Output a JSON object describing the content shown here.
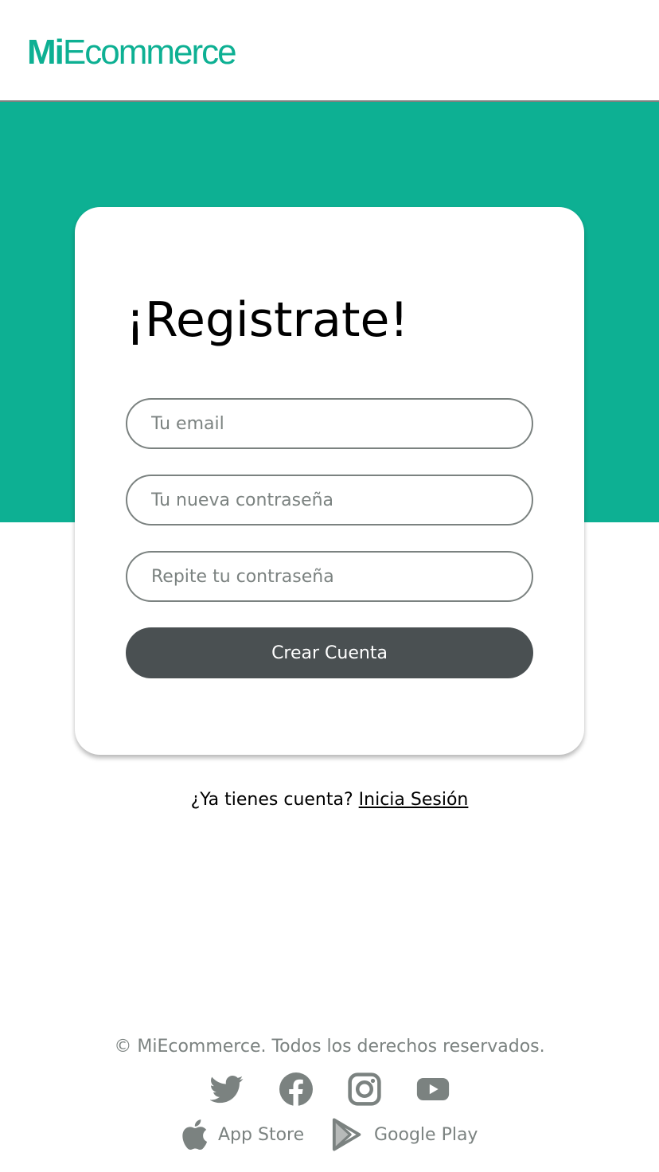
{
  "header": {
    "logo": {
      "bold": "Mi",
      "regular": "Ecommerce"
    }
  },
  "colors": {
    "brand": "#0db093",
    "button": "#4a5052",
    "muted": "#7b8280"
  },
  "form": {
    "title": "¡Registrate!",
    "email_placeholder": "Tu email",
    "password_placeholder": "Tu nueva contraseña",
    "repeat_password_placeholder": "Repite tu contraseña",
    "submit_label": "Crear Cuenta"
  },
  "login_prompt": {
    "text": "¿Ya tienes cuenta?",
    "link": "Inicia Sesión"
  },
  "footer": {
    "copyright": "© MiEcommerce. Todos los derechos reservados.",
    "social_icons": [
      "twitter-icon",
      "facebook-icon",
      "instagram-icon",
      "youtube-icon"
    ],
    "stores": [
      {
        "icon": "apple-icon",
        "label": "App Store"
      },
      {
        "icon": "google-play-icon",
        "label": "Google Play"
      }
    ]
  }
}
